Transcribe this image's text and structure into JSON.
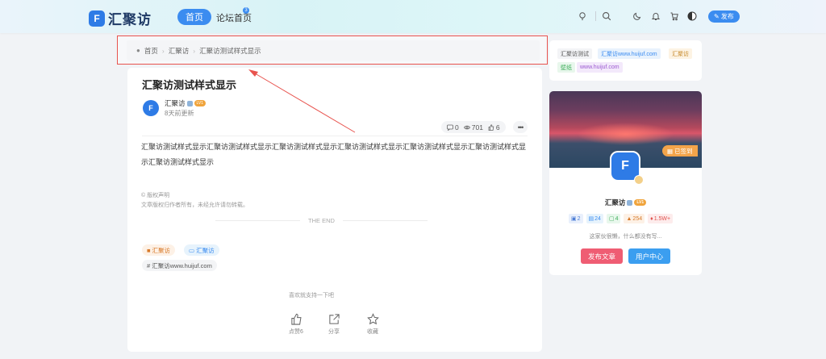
{
  "header": {
    "logo_mark": "F",
    "logo_text": "汇聚访",
    "nav_home": "首页",
    "nav_forum": "论坛首页",
    "forum_badge": "3",
    "publish_label": "发布",
    "icons": [
      "lightbulb-icon",
      "search-icon",
      "moon-icon",
      "bell-icon",
      "cart-icon",
      "theme-icon"
    ]
  },
  "breadcrumb": [
    "首页",
    "汇聚访",
    "汇聚访测试样式显示"
  ],
  "article": {
    "title": "汇聚访测试样式显示",
    "avatar_mark": "F",
    "author": "汇聚访",
    "level": "LV1",
    "updated": "8天前更新",
    "stats": {
      "comments": "0",
      "views": "701",
      "likes": "6"
    },
    "body": "汇聚访测试样式显示汇聚访测试样式显示汇聚访测试样式显示汇聚访测试样式显示汇聚访测试样式显示汇聚访测试样式显示汇聚访测试样式显示",
    "copyright_label": "© 版权声明",
    "copyright_text": "文章版权归作者所有，未经允许请勿转载。",
    "the_end": "THE END",
    "tags": {
      "category": "汇聚访",
      "folder": "汇聚访",
      "hashtag": "# 汇聚访www.huijuf.com"
    },
    "support": "喜欢就支持一下吧",
    "actions": {
      "like": "点赞6",
      "share": "分享",
      "favorite": "收藏"
    }
  },
  "sidebar": {
    "tags": [
      {
        "text": "汇聚访测试",
        "color": "#555555",
        "bg": "#f3f4f6"
      },
      {
        "text": "汇聚访www.huijuf.com",
        "color": "#3b8cf0",
        "bg": "#e8f2fd"
      },
      {
        "text": "汇聚访",
        "color": "#c78a2c",
        "bg": "#fdf3e3"
      },
      {
        "text": "壁纸",
        "color": "#3fae5a",
        "bg": "#e8f7ec"
      },
      {
        "text": "www.huijuf.com",
        "color": "#9b59d0",
        "bg": "#f3e9fb"
      }
    ],
    "profile": {
      "signed": "已签到",
      "avatar_mark": "F",
      "name": "汇聚访",
      "level": "LV1",
      "stats": [
        {
          "value": "2",
          "color": "#4f7fd6",
          "bg": "#e9f0fc",
          "icon": "comment-icon"
        },
        {
          "value": "24",
          "color": "#3b8cf0",
          "bg": "#e7f3fc",
          "icon": "document-icon"
        },
        {
          "value": "4",
          "color": "#3fae5a",
          "bg": "#e8f7ec",
          "icon": "chat-icon"
        },
        {
          "value": "254",
          "color": "#d87a2a",
          "bg": "#fdf1e6",
          "icon": "thumb-icon"
        },
        {
          "value": "1.5W+",
          "color": "#e0504c",
          "bg": "#fdecec",
          "icon": "fire-icon"
        }
      ],
      "bio": "这家伙很懒，什么都没有写...",
      "publish_btn": "发布文章",
      "user_center_btn": "用户中心"
    }
  },
  "colors": {
    "accent": "#3b8cf0",
    "annotation": "#e8534e",
    "publish_btn": "#ef5d73",
    "user_center_btn": "#3b9ef0"
  }
}
